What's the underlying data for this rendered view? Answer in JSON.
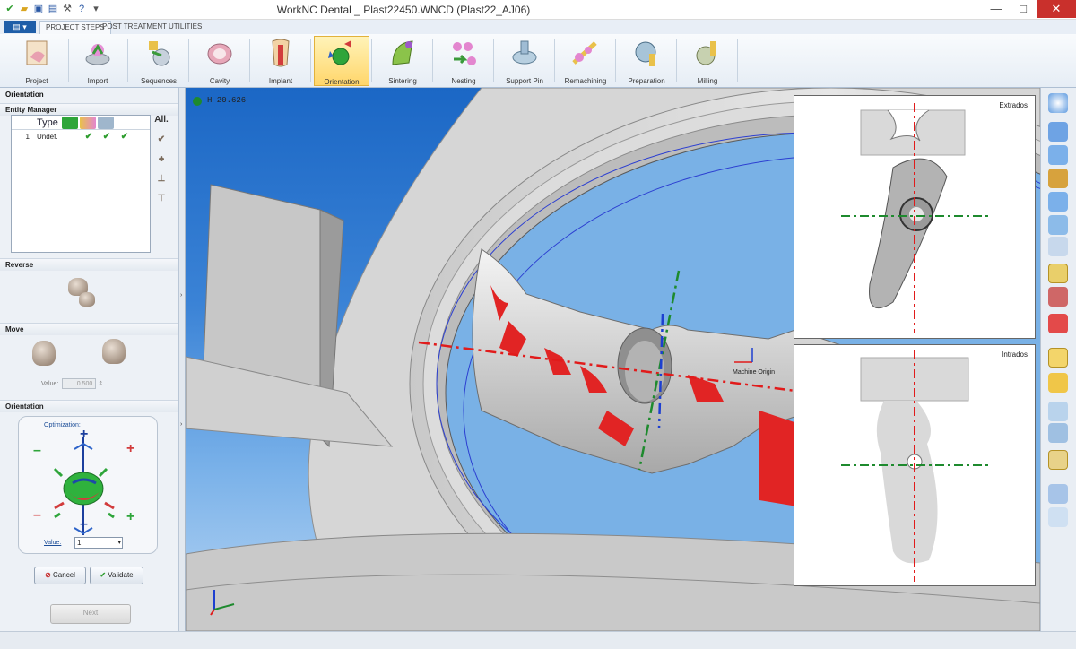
{
  "window": {
    "title": "WorkNC Dental _ Plast22450.WNCD (Plast22_AJ06)",
    "controls": {
      "minimize": "—",
      "maximize": "□",
      "close": "✕"
    }
  },
  "ribbon": {
    "tabs": [
      "PROJECT STEPS",
      "POST TREATMENT",
      "UTILITIES"
    ],
    "buttons": [
      {
        "label": "Project",
        "icon": "project-icon"
      },
      {
        "label": "Import",
        "icon": "import-icon"
      },
      {
        "label": "Sequences",
        "icon": "sequences-icon"
      },
      {
        "label": "Cavity",
        "icon": "cavity-icon"
      },
      {
        "label": "Implant",
        "icon": "implant-icon"
      },
      {
        "label": "Orientation",
        "icon": "orientation-icon",
        "active": true
      },
      {
        "label": "Sintering",
        "icon": "sintering-icon"
      },
      {
        "label": "Nesting",
        "icon": "nesting-icon"
      },
      {
        "label": "Support Pin",
        "icon": "support-pin-icon"
      },
      {
        "label": "Remachining",
        "icon": "remachining-icon"
      },
      {
        "label": "Preparation",
        "icon": "preparation-icon"
      },
      {
        "label": "Milling",
        "icon": "milling-icon"
      }
    ]
  },
  "leftPanel": {
    "title": "Orientation",
    "entityManager": {
      "title": "Entity Manager",
      "typeHeader": "Type",
      "allLabel": "All.",
      "rows": [
        {
          "index": "1",
          "type": "Undef."
        }
      ]
    },
    "reverse": {
      "title": "Reverse"
    },
    "move": {
      "title": "Move",
      "valueLabel": "Value:",
      "value": "0.500"
    },
    "orientation": {
      "title": "Orientation",
      "optimization": "Optimization:",
      "valueLabel": "Value:",
      "value": "1",
      "plus": "+",
      "minus": "–"
    },
    "buttons": {
      "cancel": "Cancel",
      "validate": "Validate",
      "next": "Next"
    }
  },
  "viewport": {
    "hReadout": "H  20.626",
    "machineOrigin": "Machine Origin",
    "extrados": "Extrados",
    "intrados": "Intrados"
  },
  "colors": {
    "accent": "#1f5ea8",
    "activeRibbon": "#ffd66b",
    "redAxis": "#e11b1b",
    "greenAxis": "#1e8a2e",
    "blueAxis": "#1d3fd0"
  }
}
